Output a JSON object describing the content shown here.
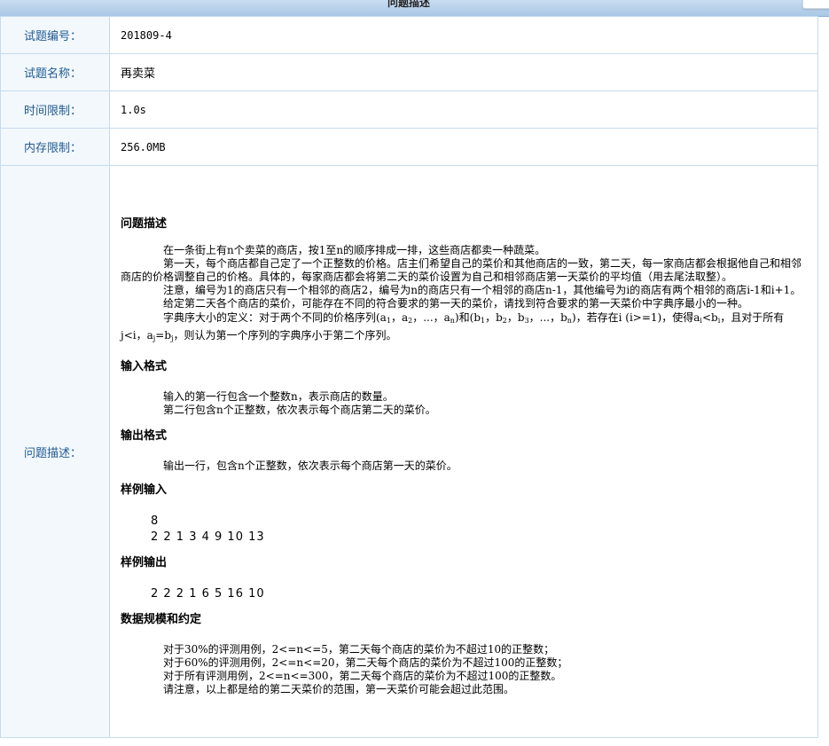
{
  "header": {
    "title": "问题描述"
  },
  "rows": [
    {
      "label": "试题编号：",
      "value": "201809-4"
    },
    {
      "label": "试题名称：",
      "value": "再卖菜"
    },
    {
      "label": "时间限制：",
      "value": "1.0s"
    },
    {
      "label": "内存限制：",
      "value": "256.0MB"
    }
  ],
  "description": {
    "label": "问题描述：",
    "problem_title": "问题描述",
    "p1": "在一条街上有n个卖菜的商店，按1至n的顺序排成一排，这些商店都卖一种蔬菜。",
    "p2": "第一天，每个商店都自己定了一个正整数的价格。店主们希望自己的菜价和其他商店的一致，第二天，每一家商店都会根据他自己和相邻商店的价格调整自己的价格。具体的，每家商店都会将第二天的菜价设置为自己和相邻商店第一天菜价的平均值（用去尾法取整）。",
    "p3": "注意，编号为1的商店只有一个相邻的商店2，编号为n的商店只有一个相邻的商店n-1，其他编号为i的商店有两个相邻的商店i-1和i+1。",
    "p4": "给定第二天各个商店的菜价，可能存在不同的符合要求的第一天的菜价，请找到符合要求的第一天菜价中字典序最小的一种。",
    "p5_a": "字典序大小的定义：对于两个不同的价格序列(a",
    "p5_b": "，a",
    "p5_c": "，...，a",
    "p5_d": ")和(b",
    "p5_e": "，b",
    "p5_f": "，b",
    "p5_g": "，...，b",
    "p5_h": ")，若存在i (i>=1)，使得a",
    "p5_i": "<b",
    "p5_j": "，且对于所有j<i，a",
    "p5_k": "=b",
    "p5_l": "，则认为第一个序列的字典序小于第二个序列。",
    "sub_1": "1",
    "sub_2": "2",
    "sub_3": "3",
    "sub_n": "n",
    "sub_i": "i",
    "sub_j": "j",
    "input_title": "输入格式",
    "input_1": "输入的第一行包含一个整数n，表示商店的数量。",
    "input_2": "第二行包含n个正整数，依次表示每个商店第二天的菜价。",
    "output_title": "输出格式",
    "output_1": "输出一行，包含n个正整数，依次表示每个商店第一天的菜价。",
    "sample_in_title": "样例输入",
    "sample_in_1": "8",
    "sample_in_2": "2 2 1 3 4 9 10 13",
    "sample_out_title": "样例输出",
    "sample_out_1": "2 2 2 1 6 5 16 10",
    "scale_title": "数据规模和约定",
    "scale_1": "对于30%的评测用例，2<=n<=5，第二天每个商店的菜价为不超过10的正整数；",
    "scale_2": "对于60%的评测用例，2<=n<=20，第二天每个商店的菜价为不超过100的正整数；",
    "scale_3": "对于所有评测用例，2<=n<=300，第二天每个商店的菜价为不超过100的正整数。",
    "scale_4": "请注意，以上都是给的第二天菜价的范围，第一天菜价可能会超过此范围。"
  }
}
